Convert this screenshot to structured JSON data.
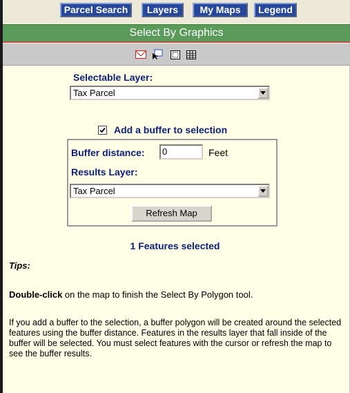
{
  "nav": {
    "buttons": [
      "Parcel Search",
      "Layers",
      "My Maps",
      "Legend"
    ]
  },
  "title": "Select By Graphics",
  "tools": [
    "envelope-polygon-icon",
    "select-pointer-icon",
    "rectangle-select-icon",
    "table-icon"
  ],
  "selectable_layer": {
    "label": "Selectable Layer:",
    "value": "Tax Parcel"
  },
  "buffer": {
    "checkbox_label": "Add a buffer to selection",
    "checked": true,
    "distance_label": "Buffer distance:",
    "distance_value": "0",
    "units": "Feet",
    "results_label": "Results Layer:",
    "results_value": "Tax Parcel",
    "refresh_label": "Refresh Map"
  },
  "status": "1 Features selected",
  "tips": {
    "heading": "Tips:",
    "line1_bold": "Double-click",
    "line1_rest": " on the map to finish the Select By Polygon tool.",
    "paragraph": "If you add a buffer to the selection, a buffer polygon will be created around the selected features using the buffer distance. Features in the results layer that fall inside of the buffer will be selected. You must select features with the cursor or refresh the map to see the buffer results."
  },
  "colors": {
    "nav_button": "#27479a",
    "title_bar": "#5a9a5a",
    "label_text": "#0d1f78",
    "panel_background": "#fefde6"
  }
}
